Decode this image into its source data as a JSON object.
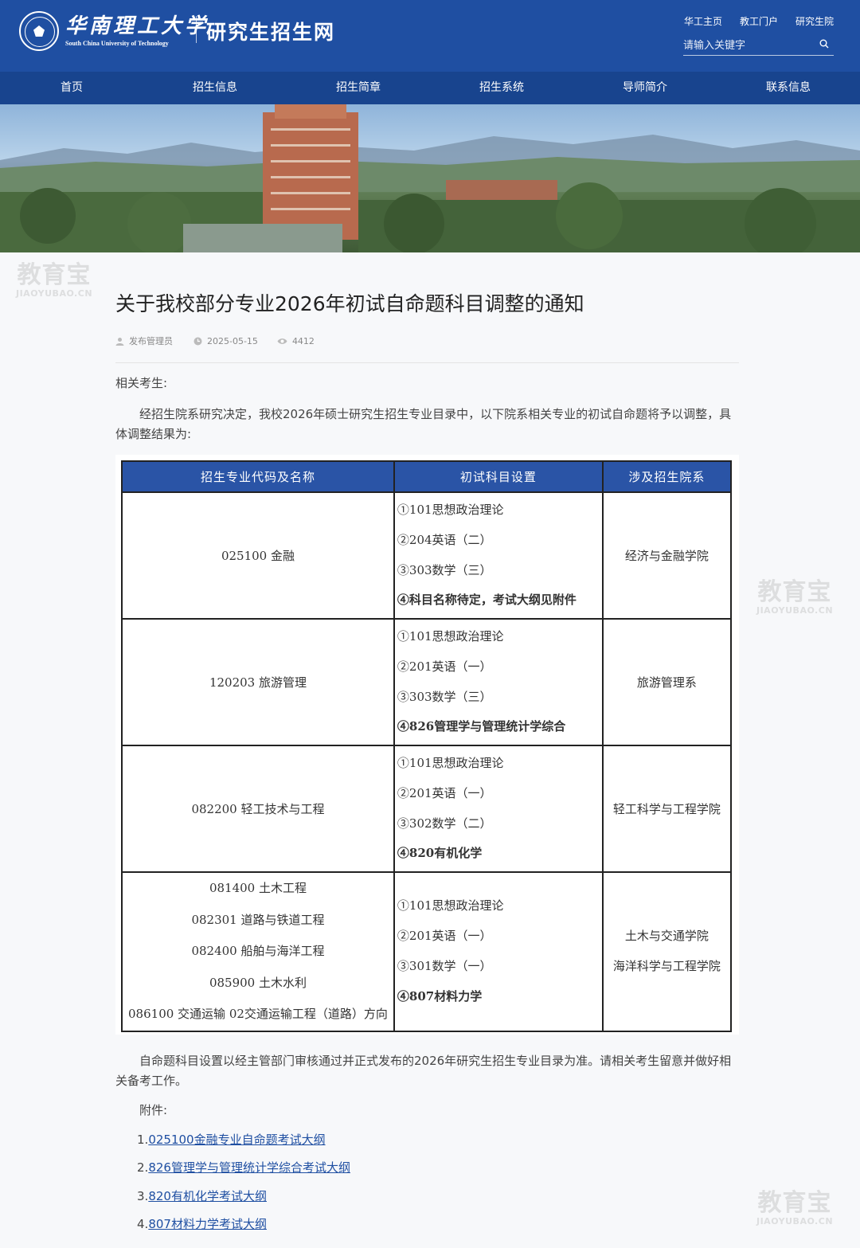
{
  "header": {
    "logo_cn": "华南理工大学",
    "logo_en": "South China University of Technology",
    "site_name": "研究生招生网",
    "top_links": [
      "华工主页",
      "教工门户",
      "研究生院"
    ],
    "search_placeholder": "请输入关键字"
  },
  "nav": [
    "首页",
    "招生信息",
    "招生简章",
    "招生系统",
    "导师简介",
    "联系信息"
  ],
  "watermark": {
    "text": "教育宝",
    "domain": "JIAOYUBAO.CN"
  },
  "article": {
    "title": "关于我校部分专业2026年初试自命题科目调整的通知",
    "author": "发布管理员",
    "date": "2025-05-15",
    "views": "4412",
    "greeting": "相关考生:",
    "intro": "经招生院系研究决定，我校2026年硕士研究生招生专业目录中，以下院系相关专业的初试自命题将予以调整，具体调整结果为:",
    "table": {
      "headers": [
        "招生专业代码及名称",
        "初试科目设置",
        "涉及招生院系"
      ],
      "rows": [
        {
          "majors": [
            "025100 金融"
          ],
          "subjects": [
            "①101思想政治理论",
            "②204英语（二）",
            "③303数学（三）",
            "④科目名称待定，考试大纲见附件"
          ],
          "depts": [
            "经济与金融学院"
          ]
        },
        {
          "majors": [
            "120203 旅游管理"
          ],
          "subjects": [
            "①101思想政治理论",
            "②201英语（一）",
            "③303数学（三）",
            "④826管理学与管理统计学综合"
          ],
          "depts": [
            "旅游管理系"
          ]
        },
        {
          "majors": [
            "082200 轻工技术与工程"
          ],
          "subjects": [
            "①101思想政治理论",
            "②201英语（一）",
            "③302数学（二）",
            "④820有机化学"
          ],
          "depts": [
            "轻工科学与工程学院"
          ]
        },
        {
          "majors": [
            "081400 土木工程",
            "082301 道路与铁道工程",
            "082400 船舶与海洋工程",
            "085900 土木水利",
            "086100 交通运输 02交通运输工程（道路）方向"
          ],
          "subjects": [
            "①101思想政治理论",
            "②201英语（一）",
            "③301数学（一）",
            "④807材料力学"
          ],
          "depts": [
            "土木与交通学院",
            "海洋科学与工程学院"
          ]
        }
      ]
    },
    "closing": "自命题科目设置以经主管部门审核通过并正式发布的2026年研究生招生专业目录为准。请相关考生留意并做好相关备考工作。",
    "attachments_label": "附件:",
    "attachments": [
      {
        "num": "1.",
        "text": "025100金融专业自命题考试大纲"
      },
      {
        "num": "2.",
        "text": "826管理学与管理统计学综合考试大纲"
      },
      {
        "num": "3.",
        "text": "820有机化学考试大纲"
      },
      {
        "num": "4.",
        "text": "807材料力学考试大纲"
      }
    ]
  }
}
